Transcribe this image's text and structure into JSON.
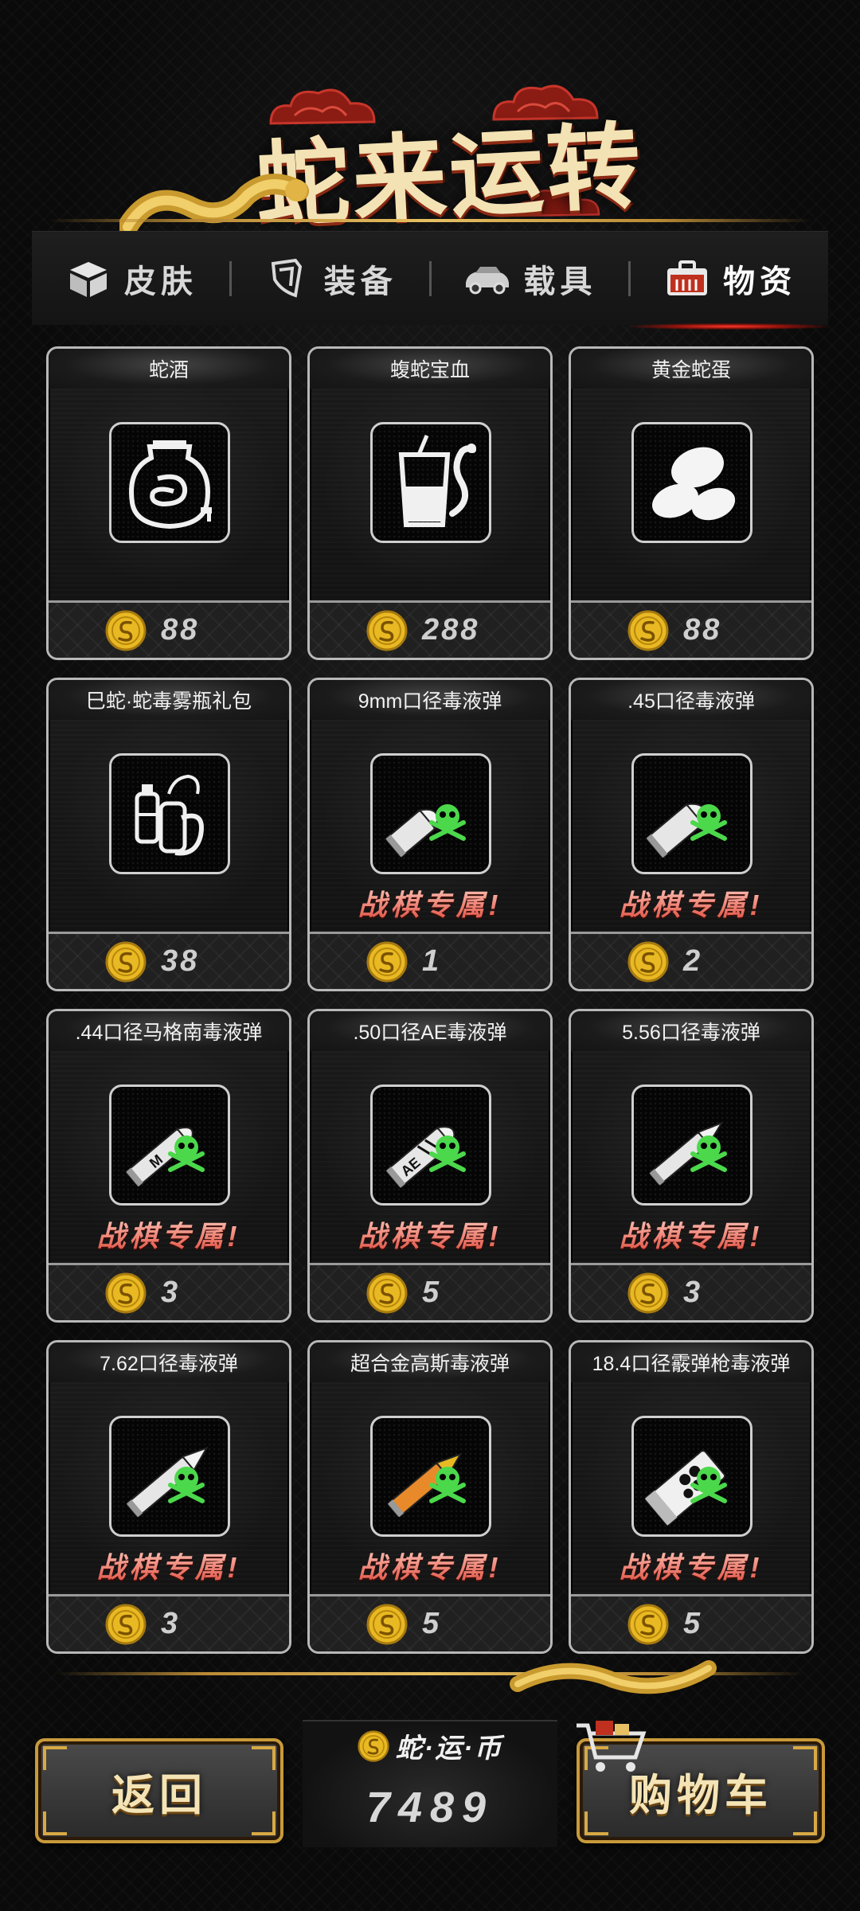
{
  "title": "蛇来运转",
  "tabs": [
    {
      "label": "皮肤",
      "icon": "box-icon"
    },
    {
      "label": "装备",
      "icon": "armor-icon"
    },
    {
      "label": "载具",
      "icon": "car-icon"
    },
    {
      "label": "物资",
      "icon": "supply-case-icon",
      "active": true
    }
  ],
  "exclusive_label": "战棋专属!",
  "items": [
    {
      "name": "蛇酒",
      "price": "88",
      "icon": "snake-wine-jar-icon",
      "exclusive": false
    },
    {
      "name": "蝮蛇宝血",
      "price": "288",
      "icon": "snake-blood-cup-icon",
      "exclusive": false
    },
    {
      "name": "黄金蛇蛋",
      "price": "88",
      "icon": "golden-eggs-icon",
      "exclusive": false
    },
    {
      "name": "巳蛇·蛇毒雾瓶礼包",
      "price": "38",
      "icon": "venom-bottle-pack-icon",
      "exclusive": false
    },
    {
      "name": "9mm口径毒液弹",
      "price": "1",
      "icon": "bullet-9mm-poison-icon",
      "exclusive": true
    },
    {
      "name": ".45口径毒液弹",
      "price": "2",
      "icon": "bullet-45-poison-icon",
      "exclusive": true
    },
    {
      "name": ".44口径马格南毒液弹",
      "price": "3",
      "icon": "bullet-44-magnum-poison-icon",
      "exclusive": true
    },
    {
      "name": ".50口径AE毒液弹",
      "price": "5",
      "icon": "bullet-50ae-poison-icon",
      "exclusive": true
    },
    {
      "name": "5.56口径毒液弹",
      "price": "3",
      "icon": "bullet-556-poison-icon",
      "exclusive": true
    },
    {
      "name": "7.62口径毒液弹",
      "price": "3",
      "icon": "bullet-762-poison-icon",
      "exclusive": true
    },
    {
      "name": "超合金高斯毒液弹",
      "price": "5",
      "icon": "gauss-round-poison-icon",
      "exclusive": true
    },
    {
      "name": "18.4口径霰弹枪毒液弹",
      "price": "5",
      "icon": "shotgun-shell-poison-icon",
      "exclusive": true
    }
  ],
  "bottom": {
    "back_label": "返回",
    "currency_label": "蛇·运·币",
    "currency_value": "7489",
    "cart_label": "购物车"
  },
  "colors": {
    "gold": "#e7c063",
    "accent_red": "#e0483a",
    "card_border": "#b8b8b8",
    "coin": "#e8b923"
  }
}
